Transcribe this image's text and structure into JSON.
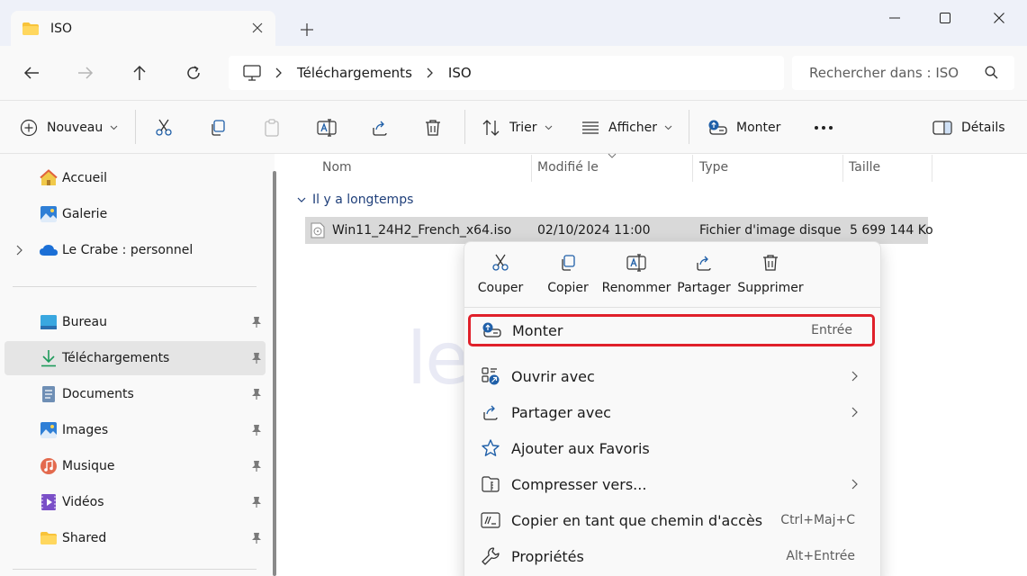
{
  "tab": {
    "title": "ISO"
  },
  "address": {
    "crumbs": [
      "Téléchargements",
      "ISO"
    ],
    "search_placeholder": "Rechercher dans : ISO"
  },
  "toolbar": {
    "new_label": "Nouveau",
    "sort_label": "Trier",
    "view_label": "Afficher",
    "mount_label": "Monter",
    "details_label": "Détails"
  },
  "sidebar": {
    "top": [
      {
        "label": "Accueil",
        "icon": "home-icon"
      },
      {
        "label": "Galerie",
        "icon": "gallery-icon"
      },
      {
        "label": "Le Crabe : personnel",
        "icon": "onedrive-icon"
      }
    ],
    "pinned": [
      {
        "label": "Bureau",
        "icon": "desktop-icon"
      },
      {
        "label": "Téléchargements",
        "icon": "downloads-icon"
      },
      {
        "label": "Documents",
        "icon": "documents-icon"
      },
      {
        "label": "Images",
        "icon": "images-icon"
      },
      {
        "label": "Musique",
        "icon": "music-icon"
      },
      {
        "label": "Vidéos",
        "icon": "videos-icon"
      },
      {
        "label": "Shared",
        "icon": "folder-icon"
      }
    ]
  },
  "columns": {
    "name": "Nom",
    "modified": "Modifié le",
    "type": "Type",
    "size": "Taille"
  },
  "group": {
    "label": "Il y a longtemps"
  },
  "file": {
    "name": "Win11_24H2_French_x64.iso",
    "modified": "02/10/2024 11:00",
    "type": "Fichier d'image disque",
    "size": "5 699 144 Ko"
  },
  "watermark": {
    "text": "lecrabeinfo"
  },
  "context_menu": {
    "quick_actions": [
      "Couper",
      "Copier",
      "Renommer",
      "Partager",
      "Supprimer"
    ],
    "items": [
      {
        "label": "Monter",
        "shortcut": "Entrée"
      },
      {
        "label": "Ouvrir avec",
        "shortcut": ""
      },
      {
        "label": "Partager avec",
        "shortcut": ""
      },
      {
        "label": "Ajouter aux Favoris",
        "shortcut": ""
      },
      {
        "label": "Compresser vers...",
        "shortcut": ""
      },
      {
        "label": "Copier en tant que chemin d'accès",
        "shortcut": "Ctrl+Maj+C"
      },
      {
        "label": "Propriétés",
        "shortcut": "Alt+Entrée"
      }
    ]
  },
  "colors": {
    "accent": "#0067c0",
    "highlight_border": "#e0202a",
    "folder": "#f8c33a"
  }
}
